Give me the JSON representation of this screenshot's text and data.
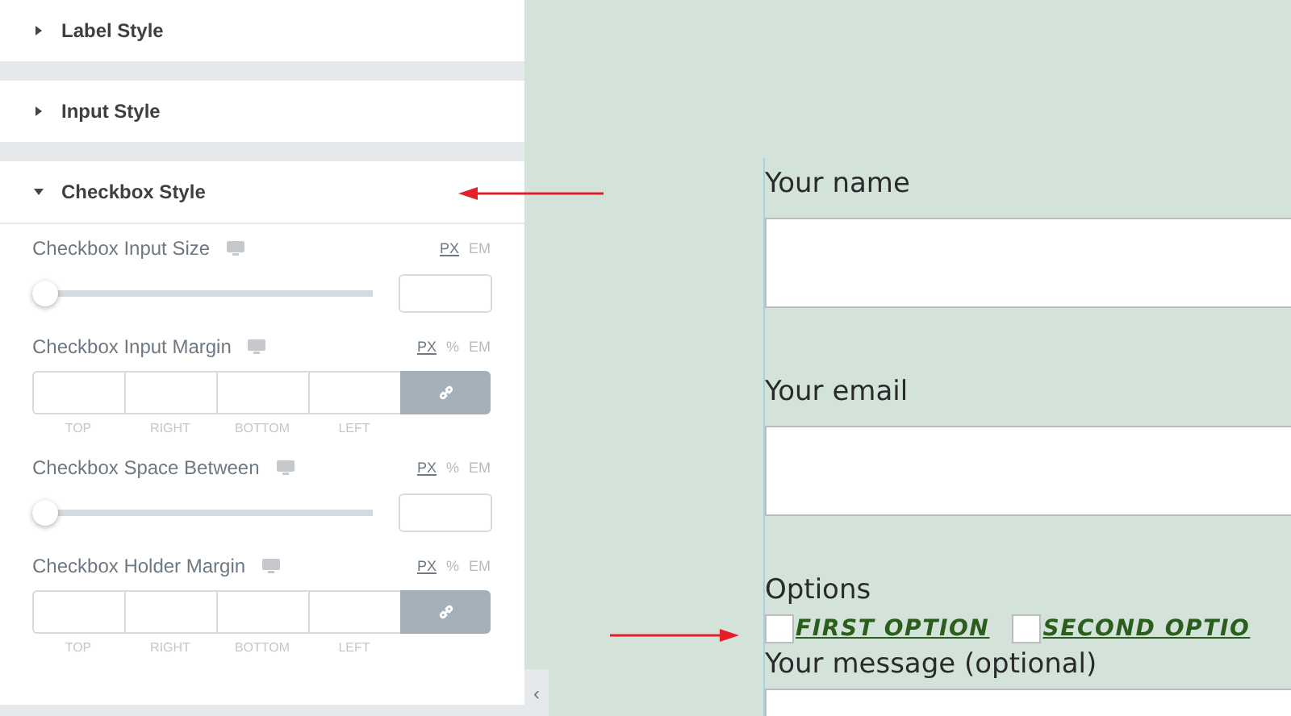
{
  "panel": {
    "sections": [
      {
        "title": "Label Style",
        "expanded": false
      },
      {
        "title": "Input Style",
        "expanded": false
      },
      {
        "title": "Checkbox Style",
        "expanded": true
      }
    ],
    "controls": [
      {
        "kind": "slider",
        "label": "Checkbox Input Size",
        "level": 0,
        "units": [
          {
            "label": "PX",
            "selected": true
          },
          {
            "label": "EM",
            "selected": false
          }
        ]
      },
      {
        "kind": "dimensions",
        "label": "Checkbox Input Margin",
        "units": [
          {
            "label": "PX",
            "selected": true
          },
          {
            "label": "%",
            "selected": false
          },
          {
            "label": "EM",
            "selected": false
          }
        ],
        "sides": [
          "TOP",
          "RIGHT",
          "BOTTOM",
          "LEFT"
        ]
      },
      {
        "kind": "slider",
        "label": "Checkbox Space Between",
        "level": 0,
        "units": [
          {
            "label": "PX",
            "selected": true
          },
          {
            "label": "%",
            "selected": false
          },
          {
            "label": "EM",
            "selected": false
          }
        ]
      },
      {
        "kind": "dimensions",
        "label": "Checkbox Holder Margin",
        "units": [
          {
            "label": "PX",
            "selected": true
          },
          {
            "label": "%",
            "selected": false
          },
          {
            "label": "EM",
            "selected": false
          }
        ],
        "sides": [
          "TOP",
          "RIGHT",
          "BOTTOM",
          "LEFT"
        ]
      }
    ],
    "collapse_toggle": "‹"
  },
  "form": {
    "fields": [
      {
        "kind": "text",
        "label": "Your name"
      },
      {
        "kind": "text",
        "label": "Your email"
      },
      {
        "kind": "checkboxes",
        "label": "Options",
        "options": [
          {
            "label": "FIRST OPTION",
            "checked": false
          },
          {
            "label": "SECOND OPTIO",
            "checked": false
          }
        ]
      },
      {
        "kind": "textarea",
        "label": "Your message (optional)"
      }
    ]
  }
}
